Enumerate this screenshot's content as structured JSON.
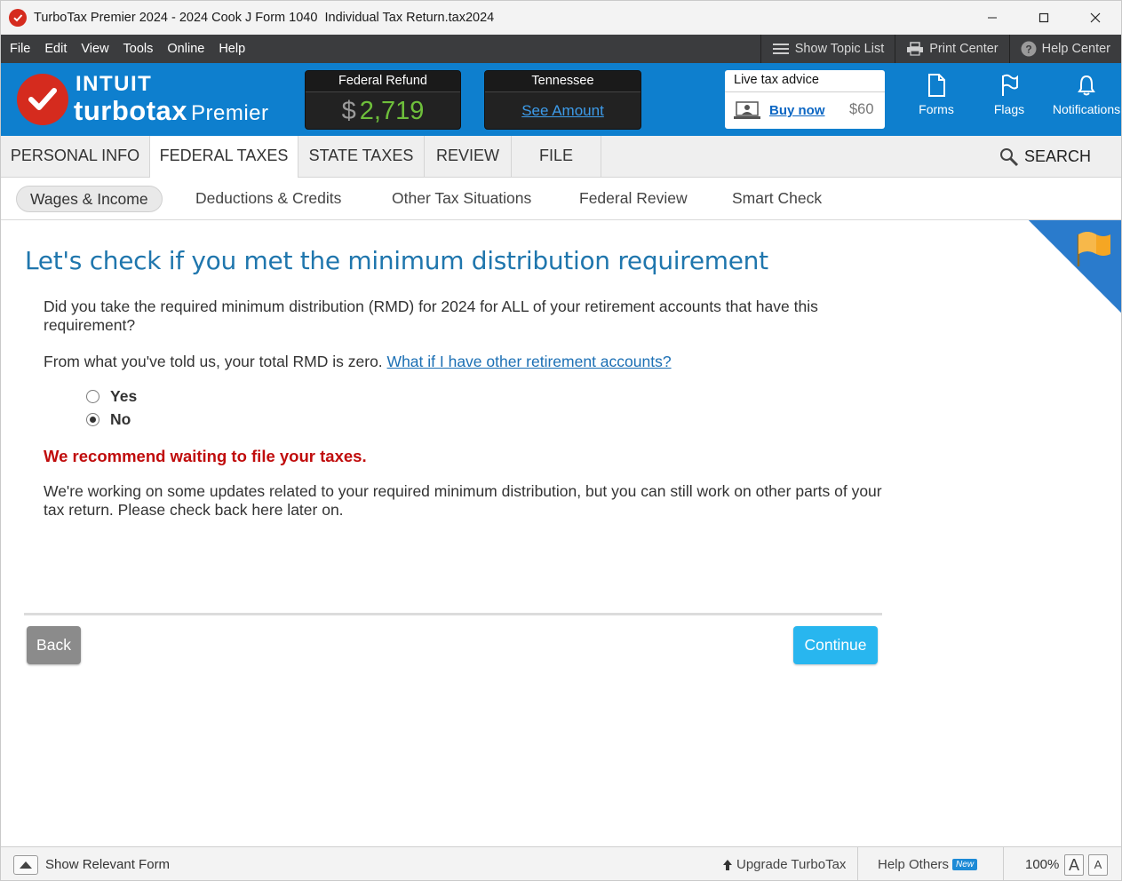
{
  "window": {
    "title": "TurboTax Premier 2024 - 2024 Cook J Form 1040  Individual Tax Return.tax2024"
  },
  "menu": {
    "items": [
      "File",
      "Edit",
      "View",
      "Tools",
      "Online",
      "Help"
    ],
    "show_topic_list": "Show Topic List",
    "print_center": "Print Center",
    "help_center": "Help Center"
  },
  "brand": {
    "company": "INTUIT",
    "product": "turbotax",
    "edition": "Premier"
  },
  "refund": {
    "federal_label": "Federal Refund",
    "federal_currency": "$",
    "federal_amount": "2,719",
    "state_label": "Tennessee",
    "state_link": "See Amount"
  },
  "advice": {
    "title": "Live tax advice",
    "buy_label": "Buy now",
    "price": "$60"
  },
  "toolbar": {
    "forms": "Forms",
    "flags": "Flags",
    "notifications": "Notifications"
  },
  "tabs": {
    "items": [
      "PERSONAL INFO",
      "FEDERAL TAXES",
      "STATE TAXES",
      "REVIEW",
      "FILE"
    ],
    "active": "FEDERAL TAXES",
    "search": "SEARCH"
  },
  "subtabs": {
    "items": [
      "Wages & Income",
      "Deductions & Credits",
      "Other Tax Situations",
      "Federal Review",
      "Smart Check"
    ],
    "active": "Wages & Income"
  },
  "content": {
    "heading": "Let's check if you met the minimum distribution requirement",
    "question": "Did you take the required minimum distribution (RMD) for 2024 for ALL of your retirement accounts that have this requirement?",
    "rmd_text": "From what you've told us, your total RMD is zero.",
    "rmd_link": "What if I have other retirement accounts?",
    "options": [
      "Yes",
      "No"
    ],
    "selected": "No",
    "warning": "We recommend waiting to file your taxes.",
    "info": "We're working on some updates related to your required minimum distribution, but you can still work on other parts of your tax return. Please check back here later on."
  },
  "buttons": {
    "back": "Back",
    "continue": "Continue"
  },
  "status": {
    "show_form": "Show Relevant Form",
    "upgrade": "Upgrade TurboTax",
    "help_others": "Help Others",
    "new_badge": "New",
    "zoom": "100%",
    "font_large": "A",
    "font_small": "A"
  },
  "colors": {
    "brand_blue": "#0e7fce",
    "refund_green": "#6ebf3b",
    "heading_blue": "#1f76ad",
    "warning_red": "#c00c0c",
    "continue_blue": "#28b6ef",
    "logo_red": "#d52b1e"
  }
}
